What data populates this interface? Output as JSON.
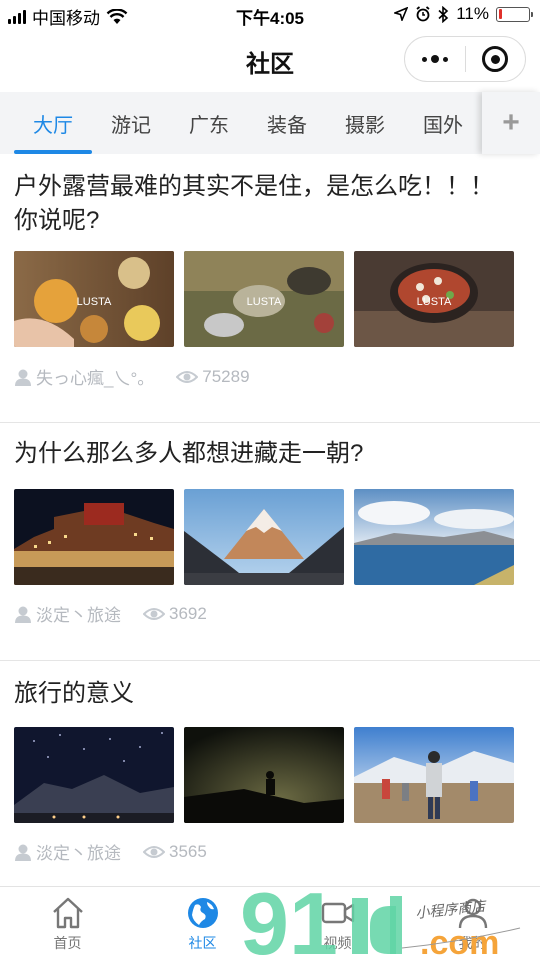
{
  "status_bar": {
    "carrier": "中国移动",
    "time": "下午4:05",
    "battery_percent": "11%",
    "battery_level": 0.11
  },
  "nav": {
    "title": "社区"
  },
  "tabs": [
    {
      "label": "大厅",
      "active": true
    },
    {
      "label": "游记",
      "active": false
    },
    {
      "label": "广东",
      "active": false
    },
    {
      "label": "装备",
      "active": false
    },
    {
      "label": "摄影",
      "active": false
    },
    {
      "label": "国外",
      "active": false
    }
  ],
  "tab_add_label": "+",
  "posts": [
    {
      "title": "户外露营最难的其实不是住，是怎么吃！！！你说呢?",
      "author": "失っ心瘋_乀°。",
      "views": "75289",
      "thumb_watermark": "LUSTA"
    },
    {
      "title": "为什么那么多人都想进藏走一朝?",
      "author": "淡定丶旅途",
      "views": "3692"
    },
    {
      "title": "旅行的意义",
      "author": "淡定丶旅途",
      "views": "3565"
    }
  ],
  "tabbar": [
    {
      "label": "首页",
      "icon": "home-icon",
      "active": false
    },
    {
      "label": "社区",
      "icon": "globe-icon",
      "active": true
    },
    {
      "label": "视频",
      "icon": "video-icon",
      "active": false
    },
    {
      "label": "我的",
      "icon": "person-icon",
      "active": false
    }
  ],
  "watermark": {
    "big": "91",
    "rest": ".com",
    "script": "小程序商店"
  },
  "colors": {
    "accent": "#1e88e5",
    "battery_low": "#e0302a",
    "meta_gray": "#b5b9bf"
  }
}
